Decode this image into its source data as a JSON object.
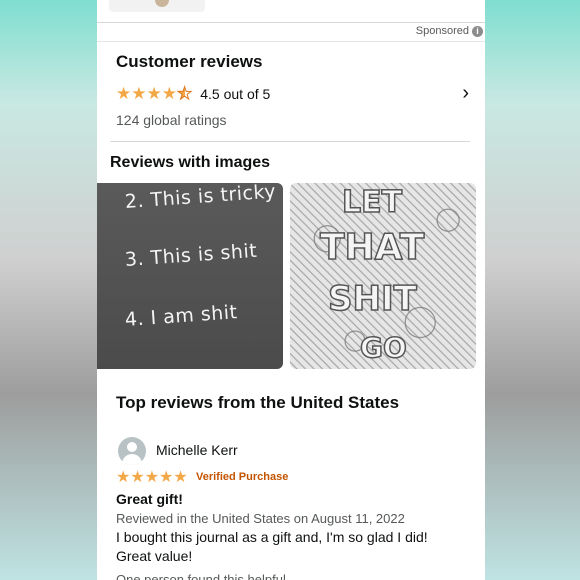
{
  "sponsored": {
    "label": "Sponsored",
    "icon": "info-icon"
  },
  "reviews_summary": {
    "title": "Customer reviews",
    "rating_value": 4.5,
    "rating_text": "4.5 out of 5",
    "global_ratings": "124 global ratings",
    "star_color": "#f3a847"
  },
  "reviews_with_images": {
    "title": "Reviews with images",
    "image1_lines": [
      "2. This is tricky",
      "3. This is shit",
      "4. I am shit"
    ],
    "image2_words": [
      "LET",
      "THAT",
      "SHIT",
      "GO"
    ]
  },
  "top_reviews": {
    "title": "Top reviews from the United States",
    "review": {
      "reviewer": "Michelle Kerr",
      "stars": 5,
      "verified": "Verified Purchase",
      "headline": "Great gift!",
      "meta": "Reviewed in the United States on August 11, 2022",
      "body": "I bought this journal as a gift and, I'm so glad I did! Great value!",
      "helpful": "One person found this helpful"
    }
  }
}
